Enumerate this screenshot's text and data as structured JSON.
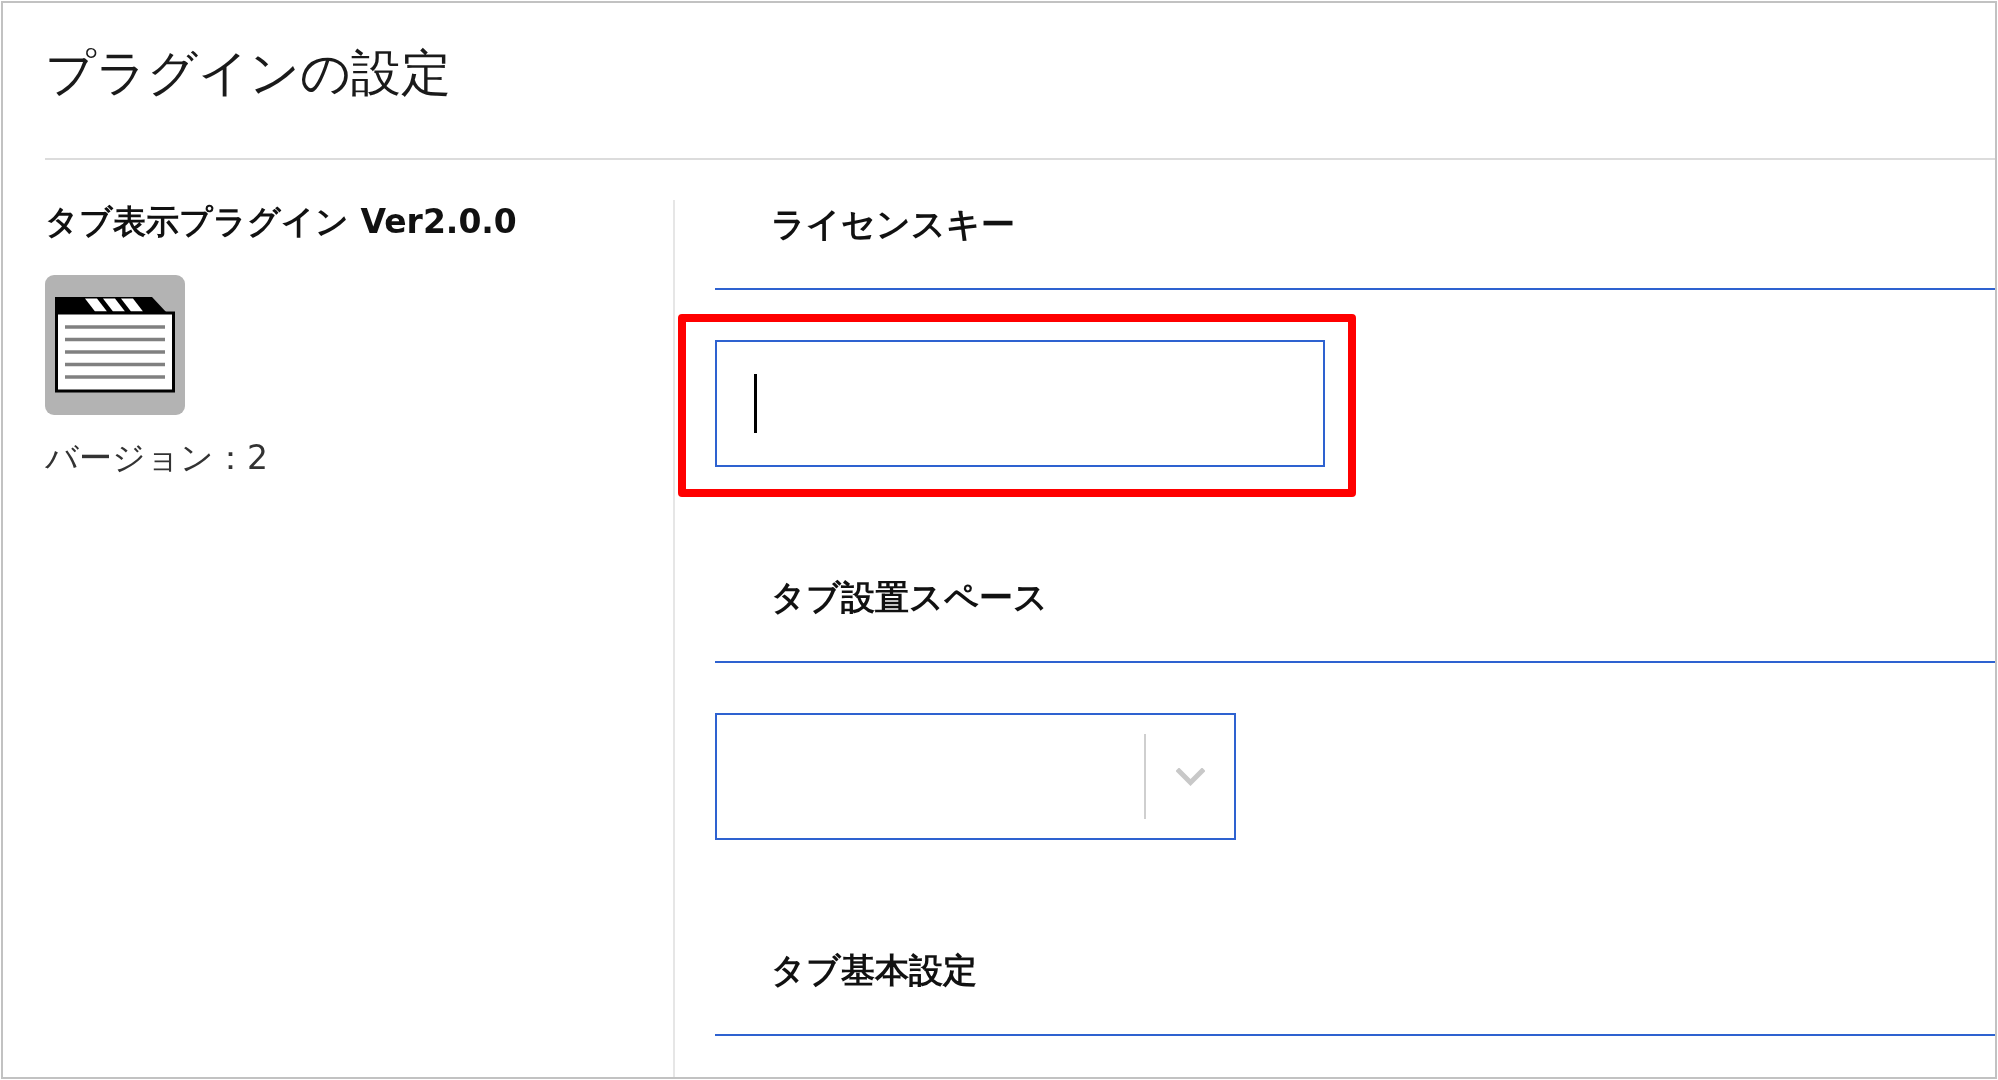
{
  "page": {
    "title": "プラグインの設定"
  },
  "plugin": {
    "name": "タブ表示プラグイン Ver2.0.0",
    "version": "バージョン：2"
  },
  "sections": [
    {
      "heading": "ライセンスキー",
      "field": {
        "kind": "text",
        "focused": true,
        "highlighted": true
      }
    },
    {
      "heading": "タブ設置スペース",
      "field": {
        "kind": "select",
        "focused": false,
        "highlighted": false
      }
    },
    {
      "heading": "タブ基本設定"
    }
  ]
}
